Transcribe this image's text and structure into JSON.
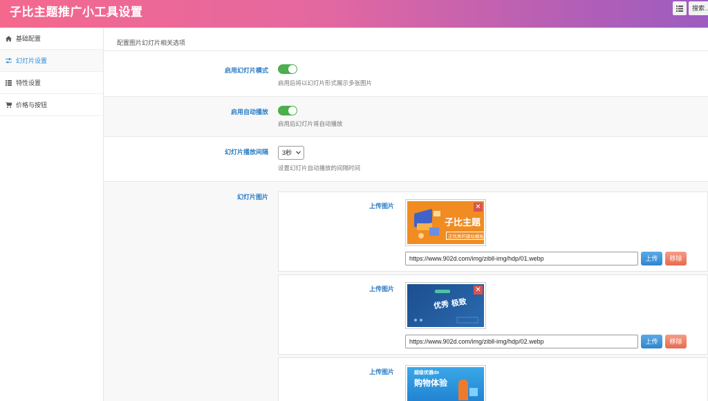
{
  "header": {
    "title": "子比主题推广小工具设置",
    "menu_icon": "list-icon",
    "search_label": "搜索..."
  },
  "sidebar": {
    "items": [
      {
        "label": "基础配置",
        "icon": "home-icon",
        "active": false
      },
      {
        "label": "幻灯片设置",
        "icon": "sliders-icon",
        "active": true
      },
      {
        "label": "特性设置",
        "icon": "list-icon",
        "active": false
      },
      {
        "label": "价格与按钮",
        "icon": "cart-icon",
        "active": false
      }
    ]
  },
  "main": {
    "section_description": "配置图片幻灯片相关选项",
    "fields": {
      "slide_mode": {
        "label": "启用幻灯片模式",
        "enabled": true,
        "help": "启用后将以幻灯片形式展示多张图片"
      },
      "autoplay": {
        "label": "启用自动播放",
        "enabled": true,
        "help": "启用后幻灯片将自动播放"
      },
      "interval": {
        "label": "幻灯片播放间隔",
        "value": "3秒",
        "help": "设置幻灯片自动播放的间隔时间"
      },
      "images": {
        "label": "幻灯片图片",
        "items": [
          {
            "upload_label": "上传图片",
            "url": "https://www.902d.com/img/zibll-img/hdp/01.webp",
            "upload_button": "上传",
            "remove_button": "移除",
            "image_text": "子比主题",
            "image_subtext": "正优质的建站模板"
          },
          {
            "upload_label": "上传图片",
            "url": "https://www.902d.com/img/zibll-img/hdp/02.webp",
            "upload_button": "上传",
            "remove_button": "移除",
            "image_text": "优秀 极致"
          },
          {
            "upload_label": "上传图片",
            "image_text": "购物体验",
            "image_subtext": "超级优雅de"
          }
        ]
      }
    }
  },
  "colors": {
    "accent": "#2b7cc4",
    "toggle_on": "#4cae4c",
    "upload": "#3b8fd6",
    "remove": "#ec7a60"
  }
}
